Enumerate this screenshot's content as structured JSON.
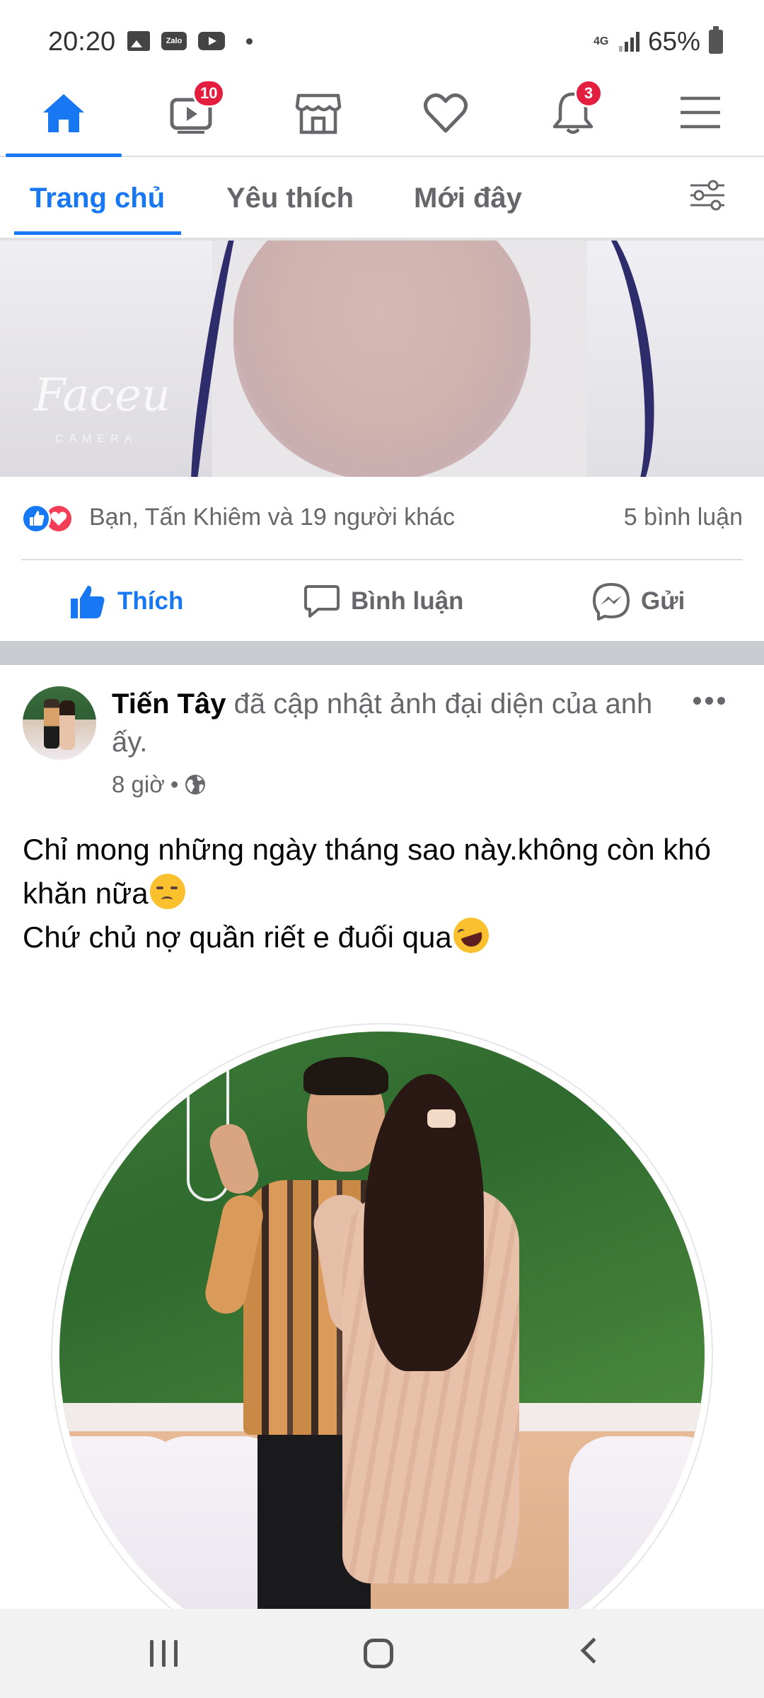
{
  "status_bar": {
    "time": "20:20",
    "notification_icons": [
      "gallery-icon",
      "zalo-icon",
      "youtube-icon"
    ],
    "zalo_label": "Zalo",
    "network": "4G",
    "battery": "65%"
  },
  "main_nav": {
    "items": [
      {
        "name": "home",
        "icon": "home-icon",
        "active": true
      },
      {
        "name": "watch",
        "icon": "video-icon",
        "badge": "10"
      },
      {
        "name": "marketplace",
        "icon": "store-icon"
      },
      {
        "name": "dating",
        "icon": "heart-icon"
      },
      {
        "name": "notifications",
        "icon": "bell-icon",
        "badge": "3"
      },
      {
        "name": "menu",
        "icon": "hamburger-icon"
      }
    ],
    "accent_color": "#1877f2",
    "badge_color": "#e41e3f"
  },
  "sub_tabs": {
    "tabs": [
      "Trang chủ",
      "Yêu thích",
      "Mới đây"
    ],
    "active": "Trang chủ"
  },
  "prev_post": {
    "watermark": "Faceu",
    "watermark_sub": "CAMERA",
    "reactions_summary": "Bạn, Tấn Khiêm và 19 người khác",
    "comments": "5 bình luận",
    "actions": {
      "like": "Thích",
      "comment": "Bình luận",
      "send": "Gửi"
    }
  },
  "post": {
    "author": "Tiến Tây",
    "action": " đã cập nhật ảnh đại diện của anh ấy.",
    "time": "8 giờ",
    "separator": "•",
    "privacy_icon": "globe-icon",
    "body_lines": [
      "Chỉ mong những ngày tháng sao này.không còn khó khăn nữa",
      "Chứ chủ nợ quần riết e đuối qua"
    ],
    "body_emojis": [
      "sad-face-emoji",
      "rolling-laughing-emoji"
    ]
  },
  "system_nav": {
    "buttons": [
      "recents-icon",
      "home-button-icon",
      "back-icon"
    ]
  }
}
